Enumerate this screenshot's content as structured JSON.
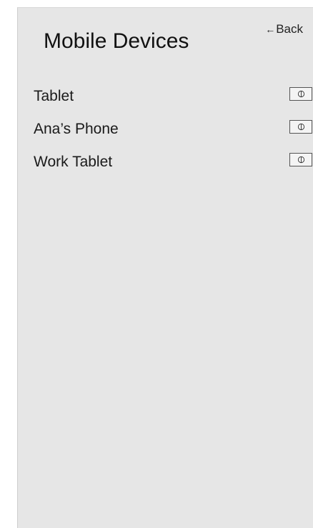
{
  "header": {
    "title": "Mobile Devices",
    "back_arrow": "←",
    "back_label": "Back"
  },
  "devices": [
    {
      "name": "Tablet",
      "icon": "power-icon"
    },
    {
      "name": "Ana’s Phone",
      "icon": "power-icon"
    },
    {
      "name": "Work Tablet",
      "icon": "power-icon"
    }
  ],
  "colors": {
    "panel_background": "#e6e6e6",
    "text": "#111111"
  }
}
